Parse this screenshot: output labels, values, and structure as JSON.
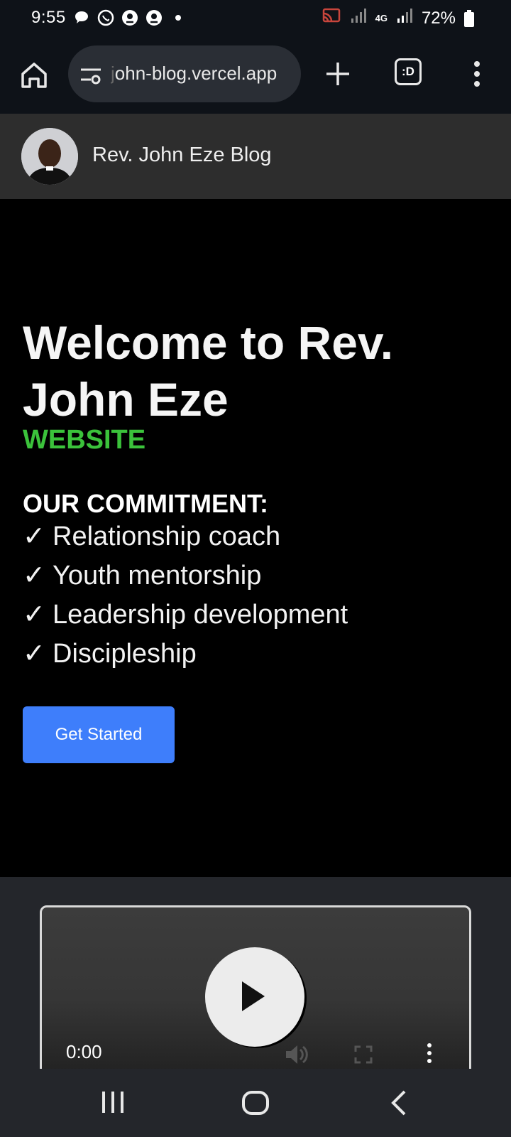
{
  "status_bar": {
    "time": "9:55",
    "battery": "72%",
    "network": "4G",
    "icons": [
      "chat-icon",
      "whatsapp-icon",
      "location-icon",
      "location-icon",
      "dot-icon",
      "cast-icon",
      "signal-icon",
      "signal-icon",
      "battery-icon"
    ]
  },
  "browser": {
    "url": "john-blog.vercel.app",
    "url_prefix": "j",
    "url_rest": "ohn-blog.vercel.app",
    "tabs_label": ":D"
  },
  "site": {
    "title": "Rev. John Eze Blog"
  },
  "hero": {
    "title": "Welcome to Rev. John Eze",
    "subtitle": "WEBSITE",
    "commitment_heading": "OUR COMMITMENT:",
    "commitments": [
      {
        "check": "✓",
        "text": "Relationship coach"
      },
      {
        "check": "✓",
        "text": "Youth mentorship"
      },
      {
        "check": "✓",
        "text": "Leadership development"
      },
      {
        "check": "✓",
        "text": "Discipleship"
      }
    ],
    "cta_label": "Get Started"
  },
  "video": {
    "time": "0:00"
  },
  "colors": {
    "accent_green": "#3bc23b",
    "cta_blue": "#3e7efb",
    "header_bg": "#2d2d2d",
    "page_bg": "#000000"
  }
}
